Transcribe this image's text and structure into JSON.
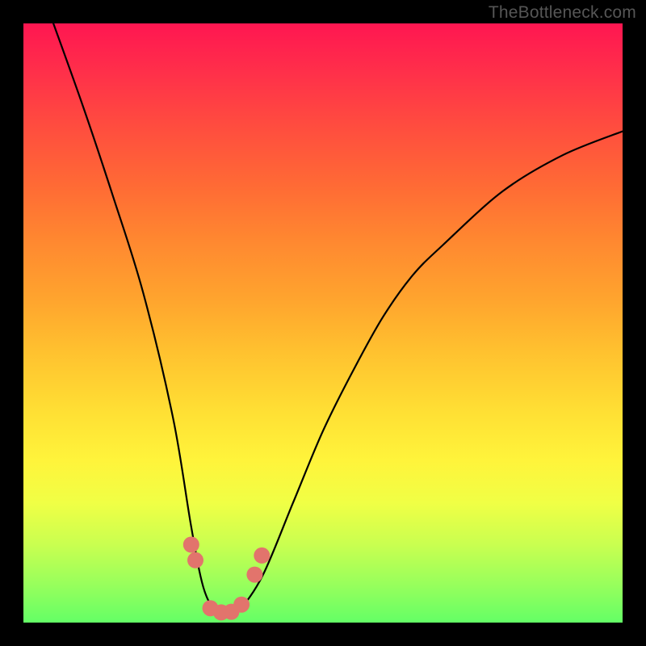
{
  "watermark": "TheBottleneck.com",
  "chart_data": {
    "type": "line",
    "title": "",
    "xlabel": "",
    "ylabel": "",
    "xlim": [
      0,
      100
    ],
    "ylim": [
      0,
      100
    ],
    "series": [
      {
        "name": "bottleneck-curve",
        "x": [
          5,
          10,
          15,
          20,
          25,
          28,
          30,
          32,
          34,
          36,
          40,
          45,
          50,
          55,
          60,
          65,
          70,
          80,
          90,
          100
        ],
        "values": [
          100,
          86,
          71,
          55,
          34,
          16,
          6,
          2,
          1,
          2,
          8,
          20,
          32,
          42,
          51,
          58,
          63,
          72,
          78,
          82
        ]
      }
    ],
    "annotations": [
      {
        "name": "left-marker-upper",
        "x": 28.0,
        "y": 13.0
      },
      {
        "name": "left-marker-lower",
        "x": 28.7,
        "y": 10.4
      },
      {
        "name": "floor-marker-1",
        "x": 31.2,
        "y": 2.4
      },
      {
        "name": "floor-marker-2",
        "x": 33.0,
        "y": 1.7
      },
      {
        "name": "floor-marker-3",
        "x": 34.7,
        "y": 1.8
      },
      {
        "name": "floor-marker-4",
        "x": 36.4,
        "y": 3.0
      },
      {
        "name": "right-marker-lower",
        "x": 38.6,
        "y": 8.0
      },
      {
        "name": "right-marker-upper",
        "x": 39.8,
        "y": 11.2
      }
    ],
    "gradient_stops": [
      {
        "pos": 0,
        "color": "#ff1651"
      },
      {
        "pos": 50,
        "color": "#ffc22f"
      },
      {
        "pos": 80,
        "color": "#f0ff45"
      },
      {
        "pos": 100,
        "color": "#64ff66"
      }
    ]
  }
}
